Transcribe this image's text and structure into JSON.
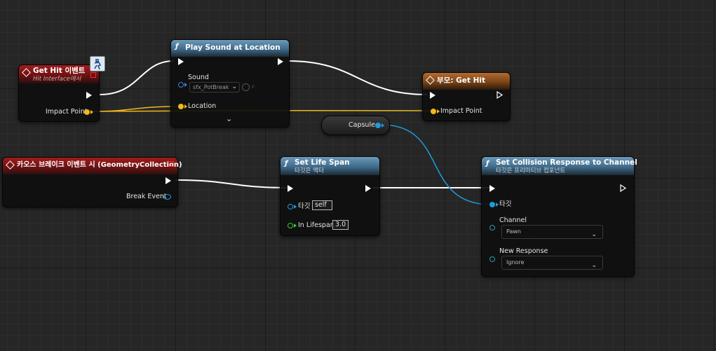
{
  "graph": {
    "get_hit_event": {
      "title": "Get Hit 이벤트",
      "subtitle": "Hit Interface에서",
      "impact_point": "Impact Point"
    },
    "play_sound": {
      "title": "Play Sound at Location",
      "sound_label": "Sound",
      "sound_value": "sfx_PotBreak",
      "location_label": "Location",
      "expand_icon": "chevron-down-icon"
    },
    "parent_get_hit": {
      "title": "부모: Get Hit",
      "impact_point": "Impact Point"
    },
    "capsule": {
      "label": "Capsule"
    },
    "chaos_break_event": {
      "title": "카오스 브레이크 이벤트 시 (GeometryCollection)",
      "break_event": "Break Event"
    },
    "set_life_span": {
      "title": "Set Life Span",
      "subtitle": "타깃은 액터",
      "target_label": "타깃",
      "target_value": "self",
      "in_lifespan_label": "In Lifespan",
      "in_lifespan_value": "3.0"
    },
    "set_collision": {
      "title": "Set Collision Response to Channel",
      "subtitle": "타깃은 프리미티브 컴포넌트",
      "target_label": "타깃",
      "channel_label": "Channel",
      "channel_value": "Pawn",
      "new_response_label": "New Response",
      "new_response_value": "Ignore"
    }
  },
  "colors": {
    "event_header": "#8b1a1a",
    "function_header": "#4a7aa0",
    "parent_header": "#9a5a24",
    "exec_wire": "#ffffff",
    "vector_wire": "#f0b81c",
    "object_wire": "#1e9bdb"
  }
}
